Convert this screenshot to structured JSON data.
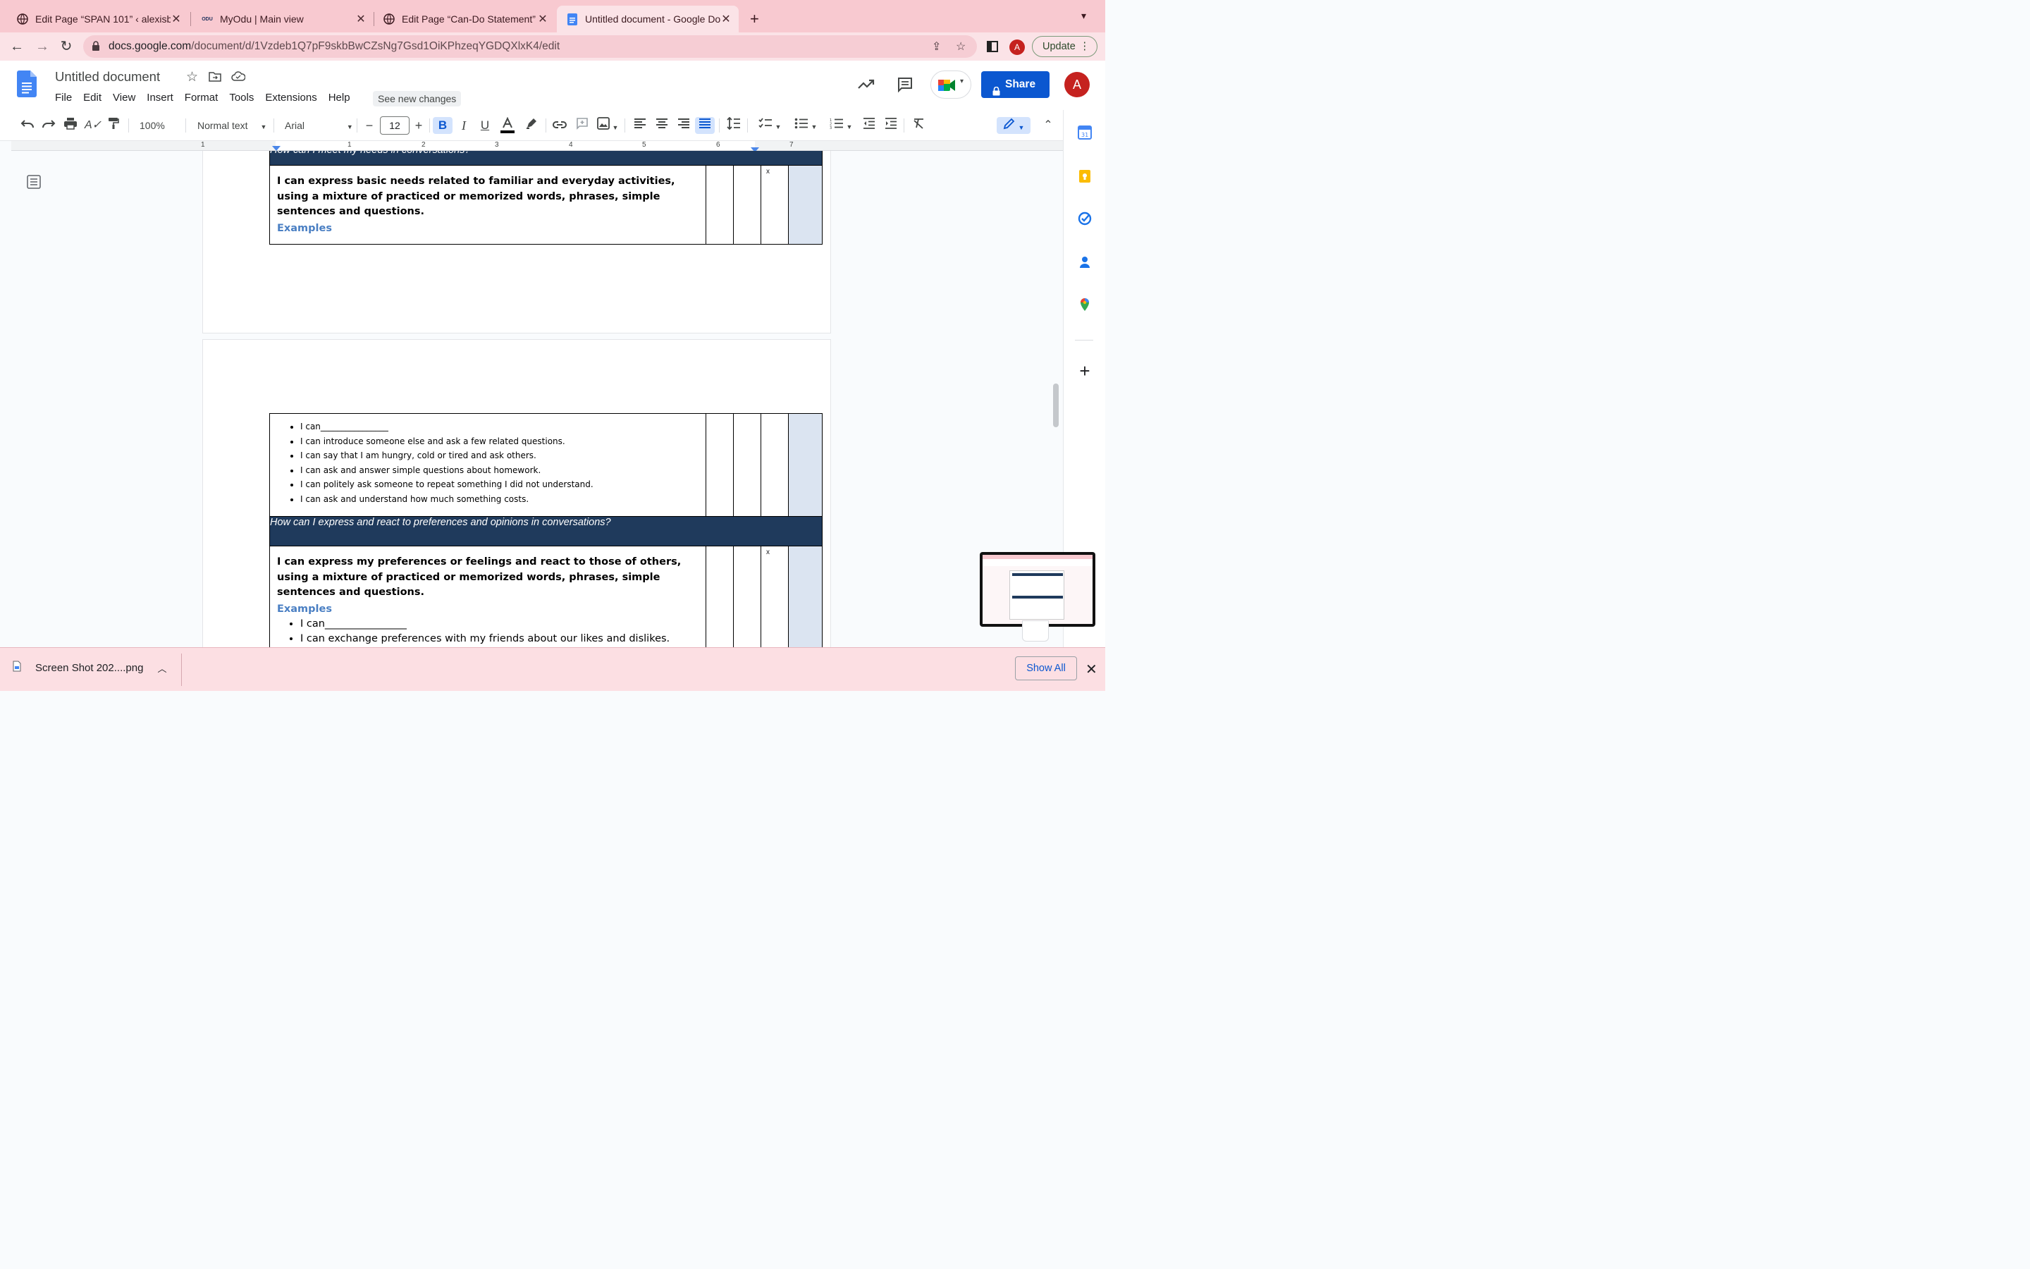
{
  "browser": {
    "tabs": [
      {
        "title": "Edit Page “SPAN 101” ‹ alexisb",
        "active": false
      },
      {
        "title": "MyOdu | Main view",
        "active": false
      },
      {
        "title": "Edit Page “Can-Do Statement”",
        "active": false
      },
      {
        "title": "Untitled document - Google Do",
        "active": true
      }
    ],
    "odu_favicon": "ODU",
    "url_host": "docs.google.com",
    "url_path": "/document/d/1Vzdeb1Q7pF9skbBwCZsNg7Gsd1OiKPhzeqYGDQXlxK4/edit",
    "profile_initial": "A",
    "update_label": "Update"
  },
  "docs": {
    "title": "Untitled document",
    "menus": [
      "File",
      "Edit",
      "View",
      "Insert",
      "Format",
      "Tools",
      "Extensions",
      "Help"
    ],
    "see_new_changes": "See new changes",
    "share_label": "Share",
    "avatar_initial": "A",
    "toolbar": {
      "zoom": "100%",
      "style": "Normal text",
      "font": "Arial",
      "font_size": "12"
    },
    "ruler_numbers": [
      "1",
      "1",
      "2",
      "3",
      "4",
      "5",
      "6",
      "7"
    ]
  },
  "document": {
    "page1": {
      "section_heading": "How can I meet my needs in conversations?",
      "statement": "I can express basic needs related to familiar and everyday activities, using a mixture of practiced or memorized words, phrases, simple sentences and questions.",
      "examples_label": "Examples",
      "mark": "x"
    },
    "page2": {
      "bullets": [
        "I can________________",
        "I can introduce someone else and ask a few related questions.",
        "I can say that I am hungry, cold or tired and ask others.",
        "I can ask and answer simple questions about homework.",
        "I can politely ask someone to repeat something I did not understand.",
        "I can ask and understand how much something costs."
      ],
      "section_heading": "How can I express and react to preferences and opinions in conversations?",
      "statement": "I can express my preferences or feelings and react to those of others, using a mixture of practiced or memorized words, phrases, simple sentences and questions.",
      "examples_label": "Examples",
      "mark": "x",
      "bullets2": [
        "I can________________",
        "I can exchange preferences with my friends about our likes and dislikes."
      ]
    }
  },
  "download_shelf": {
    "file_name": "Screen Shot 202....png",
    "show_all": "Show All"
  },
  "colors": {
    "tab_strip": "#f8c9d0",
    "table_header": "#1f3a5c",
    "examples_text": "#4a7fc3",
    "shaded_column": "#dbe4f1",
    "share_button": "#0b57d0"
  },
  "icons": [
    "globe-icon",
    "docs-icon",
    "star-icon",
    "move-icon",
    "cloud-icon",
    "trend-icon",
    "comment-icon",
    "meet-icon",
    "lock-icon",
    "undo-icon",
    "redo-icon",
    "print-icon",
    "spellcheck-icon",
    "paint-format-icon",
    "bold-icon",
    "italic-icon",
    "underline-icon",
    "text-color-icon",
    "highlight-icon",
    "link-icon",
    "add-comment-icon",
    "image-icon",
    "align-left-icon",
    "align-center-icon",
    "align-right-icon",
    "justify-icon",
    "line-spacing-icon",
    "checklist-icon",
    "bullet-list-icon",
    "numbered-list-icon",
    "decrease-indent-icon",
    "increase-indent-icon",
    "clear-format-icon",
    "edit-mode-icon",
    "collapse-icon",
    "outline-icon",
    "calendar-icon",
    "keep-icon",
    "tasks-icon",
    "contacts-icon",
    "maps-icon",
    "plus-icon",
    "close-icon"
  ]
}
